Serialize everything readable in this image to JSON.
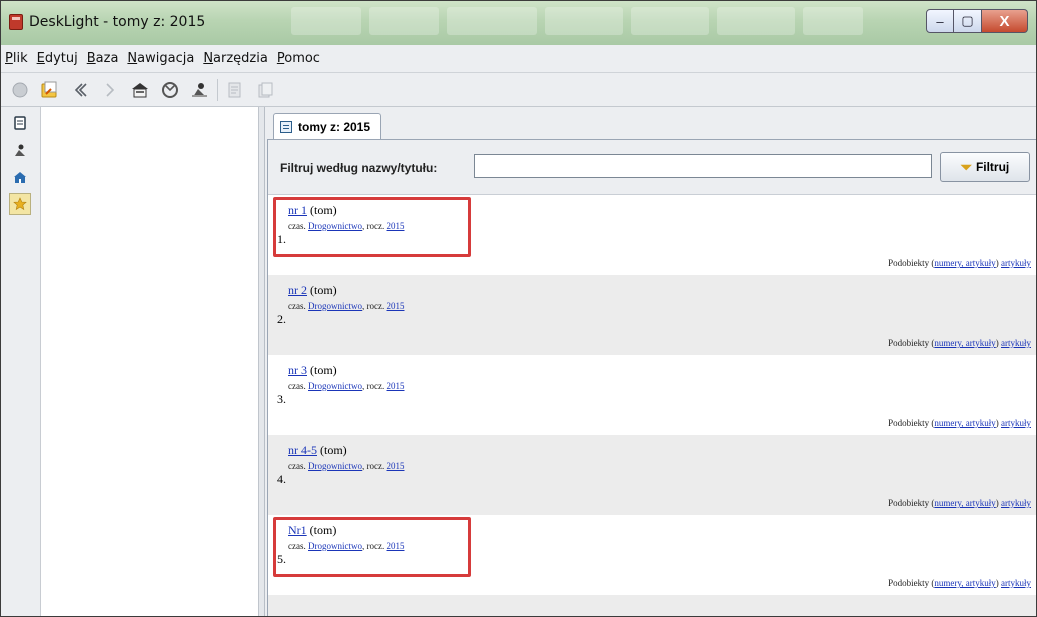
{
  "window": {
    "title": "DeskLight - tomy z: 2015",
    "controls": {
      "minimize": "–",
      "maximize": "▢",
      "close": "X"
    }
  },
  "menu": [
    {
      "accel": "P",
      "rest": "lik"
    },
    {
      "accel": "E",
      "rest": "dytuj"
    },
    {
      "accel": "B",
      "rest": "aza"
    },
    {
      "accel": "N",
      "rest": "awigacja"
    },
    {
      "accel": "N",
      "rest": "arzędzia"
    },
    {
      "accel": "P",
      "rest": "omoc"
    }
  ],
  "toolbar": {
    "icons": [
      "stop-icon",
      "open-icon",
      "back-icon",
      "forward-icon",
      "home-icon",
      "refresh-icon",
      "search-person-icon",
      "edit-icon",
      "copy-icon"
    ]
  },
  "tab": {
    "label": "tomy z: 2015"
  },
  "filter": {
    "label": "Filtruj według nazwy/tytułu:",
    "value": "",
    "button_label": "Filtruj"
  },
  "rows": [
    {
      "index": "1.",
      "link": "nr 1",
      "suffix": "(tom)",
      "meta_prefix": "czas.",
      "journal": "Drogownictwo",
      "meta_mid": ", rocz.",
      "year": "2015",
      "sub_prefix": "Podobiekty (",
      "sub_link1": "numery, artykuły",
      "sub_mid": ") ",
      "sub_link2": "artykuły",
      "highlighted": true
    },
    {
      "index": "2.",
      "link": "nr 2",
      "suffix": "(tom)",
      "meta_prefix": "czas.",
      "journal": "Drogownictwo",
      "meta_mid": ", rocz.",
      "year": "2015",
      "sub_prefix": "Podobiekty (",
      "sub_link1": "numery, artykuły",
      "sub_mid": ") ",
      "sub_link2": "artykuły",
      "highlighted": false
    },
    {
      "index": "3.",
      "link": "nr 3",
      "suffix": "(tom)",
      "meta_prefix": "czas.",
      "journal": "Drogownictwo",
      "meta_mid": ", rocz.",
      "year": "2015",
      "sub_prefix": "Podobiekty (",
      "sub_link1": "numery, artykuły",
      "sub_mid": ") ",
      "sub_link2": "artykuły",
      "highlighted": false
    },
    {
      "index": "4.",
      "link": "nr 4-5",
      "suffix": "(tom)",
      "meta_prefix": "czas.",
      "journal": "Drogownictwo",
      "meta_mid": ", rocz.",
      "year": "2015",
      "sub_prefix": "Podobiekty (",
      "sub_link1": "numery, artykuły",
      "sub_mid": ") ",
      "sub_link2": "artykuły",
      "highlighted": false
    },
    {
      "index": "5.",
      "link": "Nr1",
      "suffix": "(tom)",
      "meta_prefix": "czas.",
      "journal": "Drogownictwo",
      "meta_mid": ", rocz.",
      "year": "2015",
      "sub_prefix": "Podobiekty (",
      "sub_link1": "numery, artykuły",
      "sub_mid": ") ",
      "sub_link2": "artykuły",
      "highlighted": true
    }
  ],
  "colors": {
    "link": "#1a35b8",
    "highlight": "#d63b3b",
    "title_bar": "#b8d4b2"
  }
}
